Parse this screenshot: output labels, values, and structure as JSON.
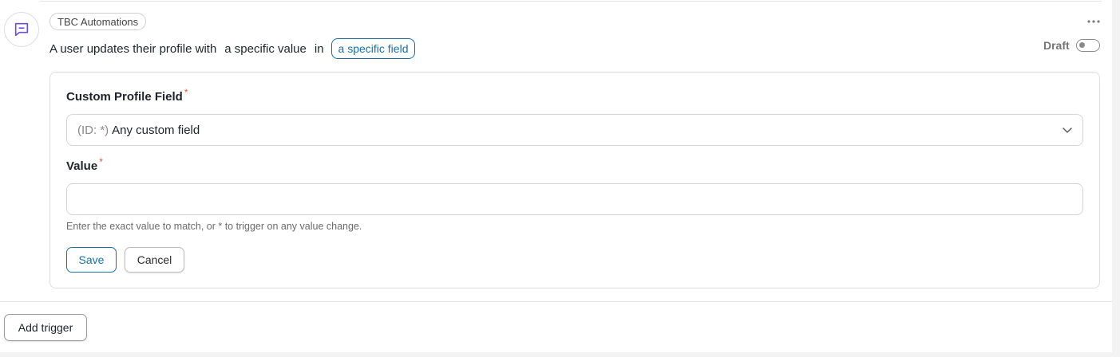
{
  "trigger": {
    "icon": "message-square-icon",
    "tag": "TBC Automations",
    "sentence": {
      "part1": "A user updates their profile with",
      "part2": "a specific value",
      "part3": "in",
      "field_chip": "a specific field"
    },
    "status_label": "Draft",
    "enabled": false
  },
  "form": {
    "custom_field": {
      "label": "Custom Profile Field",
      "required_mark": "*",
      "selected_id_prefix": "(ID: *)",
      "selected_value": "Any custom field"
    },
    "value": {
      "label": "Value",
      "required_mark": "*",
      "current_value": "",
      "helper": "Enter the exact value to match, or * to trigger on any value change."
    },
    "save_label": "Save",
    "cancel_label": "Cancel"
  },
  "footer": {
    "add_trigger_label": "Add trigger"
  },
  "colors": {
    "accent": "#1b6fa3",
    "icon_purple": "#6b4fd8",
    "required": "#e0573f"
  }
}
